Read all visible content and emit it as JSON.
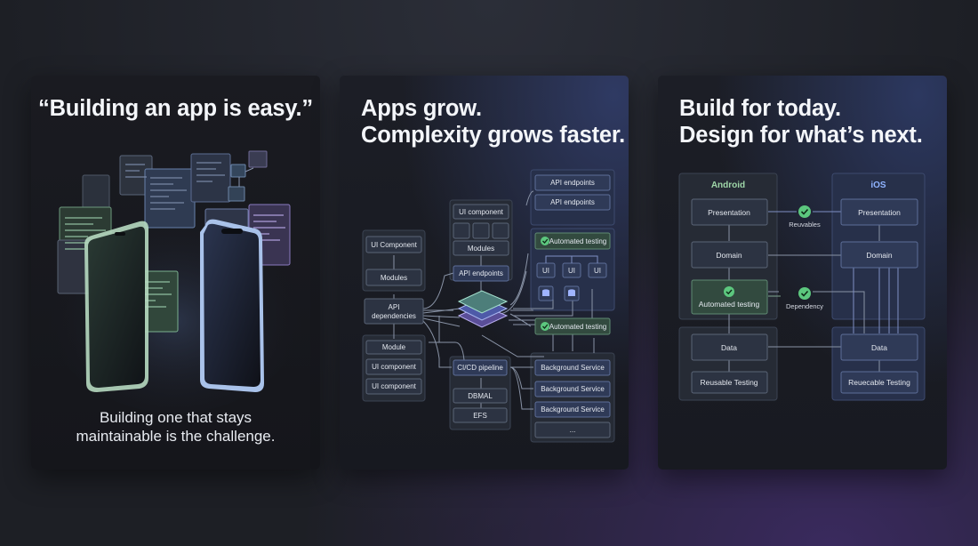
{
  "panel1": {
    "title": "“Building an app is easy.”",
    "subtitle_line1": "Building one that stays",
    "subtitle_line2": "maintainable is the challenge."
  },
  "panel2": {
    "title_line1": "Apps grow.",
    "title_line2": "Complexity grows faster.",
    "left_nodes": [
      "UI Component",
      "Modules"
    ],
    "api_dependencies": "API dependencies",
    "bottom_left_nodes": [
      "Module",
      "UI component",
      "UI component"
    ],
    "center_top": "UI component",
    "modules": "Modules",
    "api_endpoints_mid": "API endpoints",
    "right_top_nodes": [
      "API endpoints",
      "API endpoints"
    ],
    "automated_testing": [
      "Automated testing",
      "Automated testing"
    ],
    "ui_labels": [
      "UI",
      "UI",
      "UI"
    ],
    "cicd": "CI/CD pipeline",
    "bottom_mid_nodes": [
      "DBMAL",
      "EFS"
    ],
    "background_services": [
      "Background Service",
      "Background Service",
      "Background Service"
    ],
    "ellipsis": "..."
  },
  "panel3": {
    "title_line1": "Build for today.",
    "title_line2": "Design for what’s next.",
    "android_header": "Android",
    "ios_header": "iOS",
    "android_nodes": [
      "Presentation",
      "Domain",
      "Automated testing"
    ],
    "ios_nodes": [
      "Presentation",
      "Domain"
    ],
    "reusables": "Reuvables",
    "dependency": "Dependency",
    "android_data": [
      "Data",
      "Reusable Testing"
    ],
    "ios_data": [
      "Data",
      "Reuecable Testing"
    ]
  },
  "colors": {
    "android_accent": "#9fd7a9",
    "ios_accent": "#8fb3ff",
    "check_green": "#5cc77e"
  }
}
